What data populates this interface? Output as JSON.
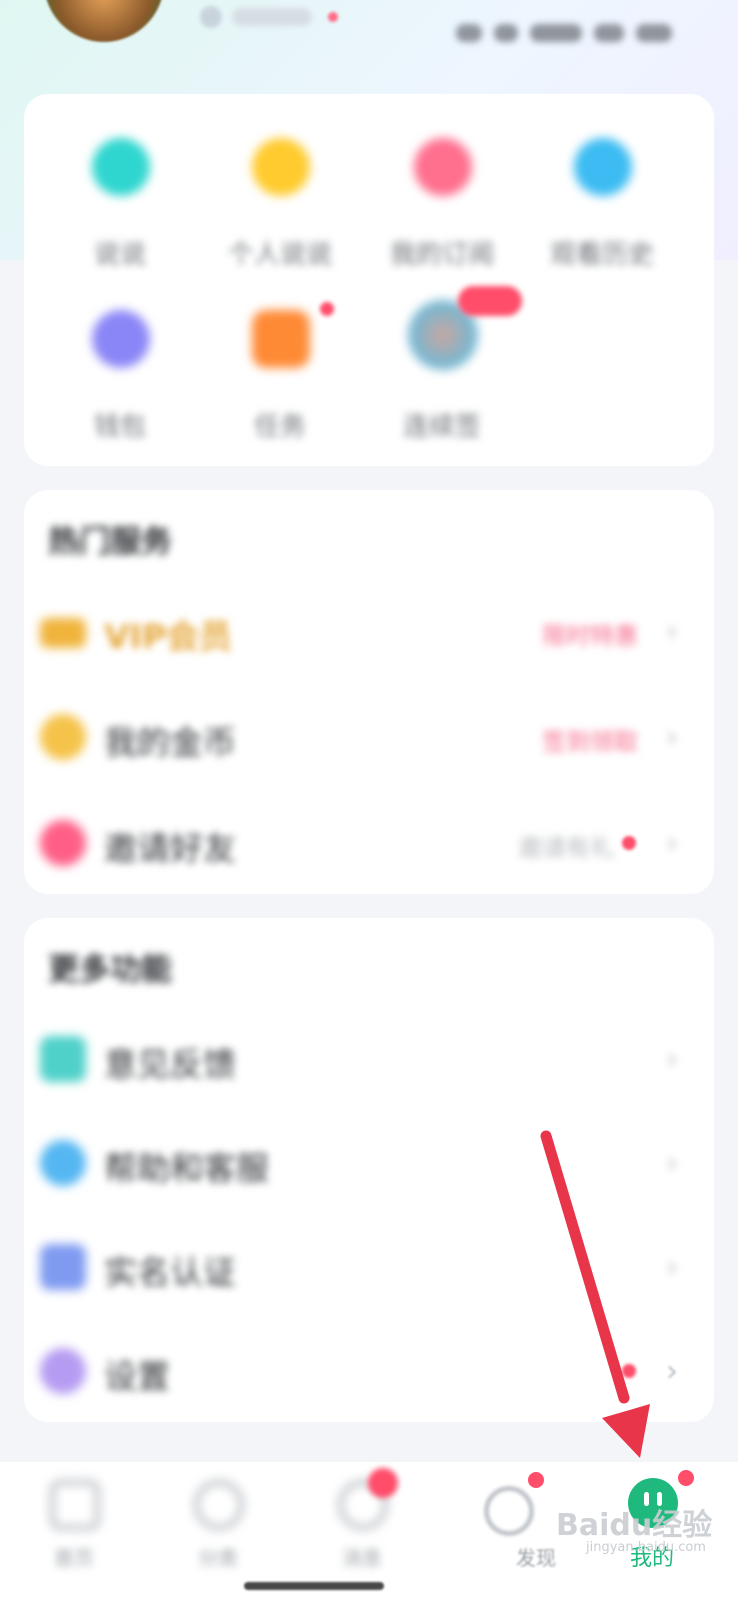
{
  "header": {},
  "quick_grid": {
    "items": [
      {
        "label": "说说",
        "icon": "house-icon",
        "color": "#2fd6cf"
      },
      {
        "label": "个人说说",
        "icon": "bulb-icon",
        "color": "#ffcb2e"
      },
      {
        "label": "我的订阅",
        "icon": "bag-icon",
        "color": "#ff6f8e"
      },
      {
        "label": "观看历史",
        "icon": "clock-icon",
        "color": "#3cbcf2"
      },
      {
        "label": "钱包",
        "icon": "wallet-icon",
        "color": "#8b86f7"
      },
      {
        "label": "任务",
        "icon": "gift-icon",
        "color": "#ff8a35"
      },
      {
        "label": "连续签",
        "icon": "avatar-icon",
        "color": "#6fb9d6"
      }
    ]
  },
  "hot_services": {
    "title": "热门服务",
    "items": [
      {
        "label": "VIP会员",
        "value": "限时特惠",
        "icon": "crown-icon",
        "color": "#f0b43c",
        "label_color": "#e5a63a",
        "value_color": "#f56a8a"
      },
      {
        "label": "我的金币",
        "value": "签到领取",
        "icon": "coin-icon",
        "color": "#f5c34a",
        "label_color": "#2b2f33",
        "value_color": "#f56a8a"
      },
      {
        "label": "邀请好友",
        "value": "邀请有礼",
        "icon": "people-icon",
        "color": "#ff5f87",
        "label_color": "#2b2f33",
        "value_color": "#b4b8bd"
      }
    ]
  },
  "more_features": {
    "title": "更多功能",
    "items": [
      {
        "label": "意见反馈",
        "icon": "calendar-icon",
        "color": "#4fd1c9"
      },
      {
        "label": "帮助和客服",
        "icon": "headset-icon",
        "color": "#55b7f2"
      },
      {
        "label": "实名认证",
        "icon": "id-card-icon",
        "color": "#7f9bf1"
      },
      {
        "label": "设置",
        "icon": "settings-icon",
        "color": "#b59cf2"
      }
    ]
  },
  "tabbar": {
    "items": [
      {
        "label": "首页",
        "icon": "home-icon"
      },
      {
        "label": "分类",
        "icon": "category-icon"
      },
      {
        "label": "消息",
        "icon": "message-icon"
      },
      {
        "label": "发现",
        "icon": "discover-icon"
      },
      {
        "label": "我的",
        "icon": "profile-icon",
        "active": true
      }
    ],
    "active_color": "#1fb97d",
    "badge_color": "#ff4d6a"
  },
  "watermark": {
    "text": "Baidu经验",
    "sub": "jingyan.baidu.com"
  },
  "annotation": {
    "color": "#e8354a",
    "target": "我的"
  }
}
